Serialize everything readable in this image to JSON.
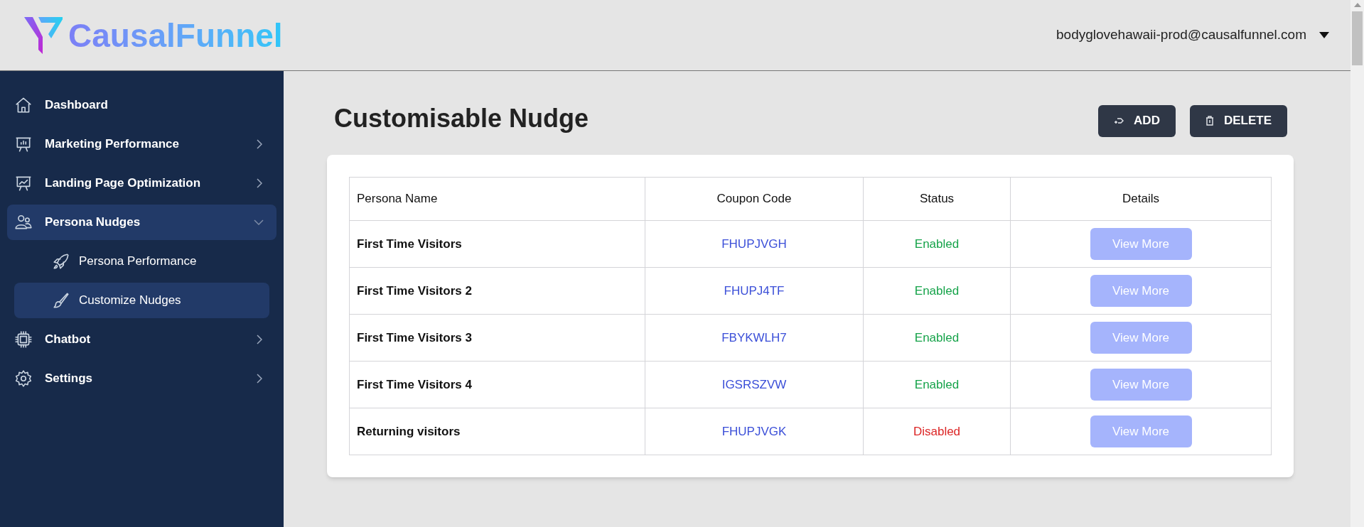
{
  "header": {
    "logo_text": "CausalFunnel",
    "account": "bodyglovehawaii-prod@causalfunnel.com"
  },
  "sidebar": {
    "items": [
      {
        "label": "Dashboard",
        "kind": "link",
        "selected": false
      },
      {
        "label": "Marketing Performance",
        "kind": "group",
        "expanded": false,
        "selected": false
      },
      {
        "label": "Landing Page Optimization",
        "kind": "group",
        "expanded": false,
        "selected": false
      },
      {
        "label": "Persona Nudges",
        "kind": "group",
        "expanded": true,
        "selected": true,
        "children": [
          {
            "label": "Persona Performance",
            "selected": false
          },
          {
            "label": "Customize Nudges",
            "selected": true
          }
        ]
      },
      {
        "label": "Chatbot",
        "kind": "group",
        "expanded": false,
        "selected": false
      },
      {
        "label": "Settings",
        "kind": "group",
        "expanded": false,
        "selected": false
      }
    ]
  },
  "page": {
    "title": "Customisable Nudge",
    "buttons": [
      {
        "label": "ADD",
        "kind": "add"
      },
      {
        "label": "DELETE",
        "kind": "delete"
      }
    ]
  },
  "table": {
    "columns": [
      "Persona Name",
      "Coupon Code",
      "Status",
      "Details"
    ],
    "rows": [
      {
        "persona_name": "First Time Visitors",
        "coupon_code": "FHUPJVGH",
        "status": "Enabled",
        "enabled": true,
        "details": "View More"
      },
      {
        "persona_name": "First Time Visitors 2",
        "coupon_code": "FHUPJ4TF",
        "status": "Enabled",
        "enabled": true,
        "details": "View More"
      },
      {
        "persona_name": "First Time Visitors 3",
        "coupon_code": "FBYKWLH7",
        "status": "Enabled",
        "enabled": true,
        "details": "View More"
      },
      {
        "persona_name": "First Time Visitors 4",
        "coupon_code": "IGSRSZVW",
        "status": "Enabled",
        "enabled": true,
        "details": "View More"
      },
      {
        "persona_name": "Returning visitors",
        "coupon_code": "FHUPJVGK",
        "status": "Disabled",
        "enabled": false,
        "details": "View More"
      }
    ]
  }
}
